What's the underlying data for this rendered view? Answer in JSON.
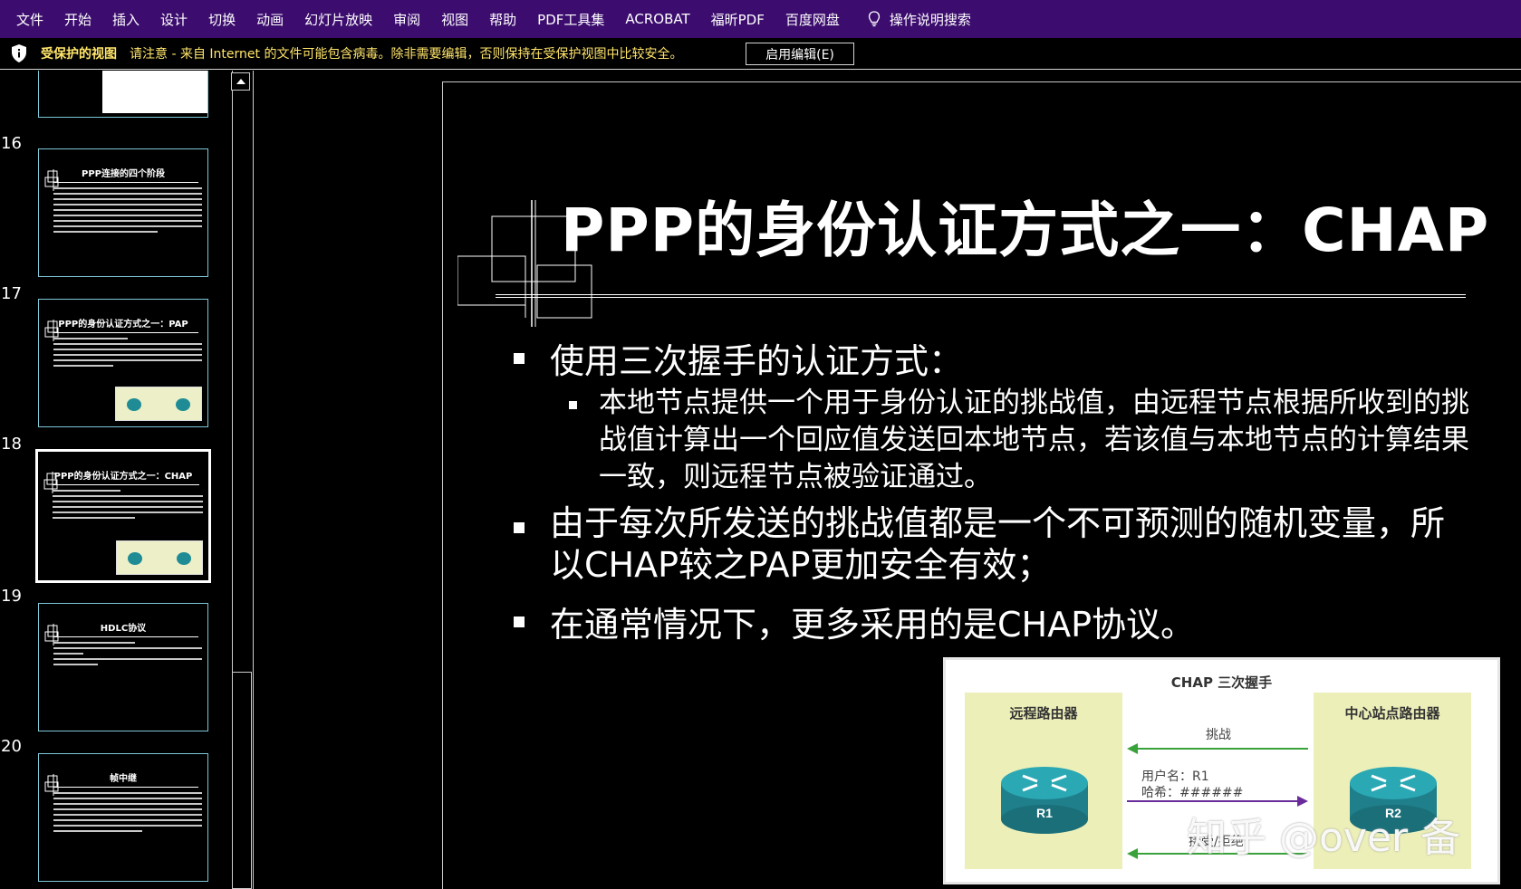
{
  "menu": {
    "items": [
      "文件",
      "开始",
      "插入",
      "设计",
      "切换",
      "动画",
      "幻灯片放映",
      "审阅",
      "视图",
      "帮助",
      "PDF工具集",
      "ACROBAT",
      "福昕PDF",
      "百度网盘"
    ],
    "search_label": "操作说明搜索"
  },
  "protected_view": {
    "title": "受保护的视图",
    "message": "请注意 - 来自 Internet 的文件可能包含病毒。除非需要编辑，否则保持在受保护视图中比较安全。",
    "enable_button": "启用编辑(E)"
  },
  "thumbnails": [
    {
      "num": "16",
      "title": "PPP连接的四个阶段"
    },
    {
      "num": "17",
      "title": "PPP的身份认证方式之一：PAP"
    },
    {
      "num": "18",
      "title": "PPP的身份认证方式之一：CHAP"
    },
    {
      "num": "19",
      "title": "HDLC协议"
    },
    {
      "num": "20",
      "title": "帧中继"
    }
  ],
  "slide": {
    "title": "PPP的身份认证方式之一：CHAP",
    "bullet1": "使用三次握手的认证方式：",
    "bullet1_sub": "本地节点提供一个用于身份认证的挑战值，由远程节点根据所收到的挑战值计算出一个回应值发送回本地节点，若该值与本地节点的计算结果一致，则远程节点被验证通过。",
    "bullet2": "由于每次所发送的挑战值都是一个不可预测的随机变量，所以CHAP较之PAP更加安全有效；",
    "bullet3": "在通常情况下，更多采用的是CHAP协议。"
  },
  "diagram": {
    "title": "CHAP 三次握手",
    "left_title": "远程路由器",
    "right_title": "中心站点路由器",
    "left_router": "R1",
    "right_router": "R2",
    "challenge": "挑战",
    "username": "用户名：R1",
    "hash": "哈希：######",
    "result": "接受/拒绝"
  },
  "watermark": "知乎 @over 备",
  "colors": {
    "ribbon": "#3c0d6e",
    "warning_text": "#ffe56a",
    "thumb_border": "#7ec8d8",
    "panel": "#ecefb8",
    "router": "#1f8c95",
    "arrow_green": "#3aa23a",
    "arrow_purple": "#6a2c9a"
  }
}
